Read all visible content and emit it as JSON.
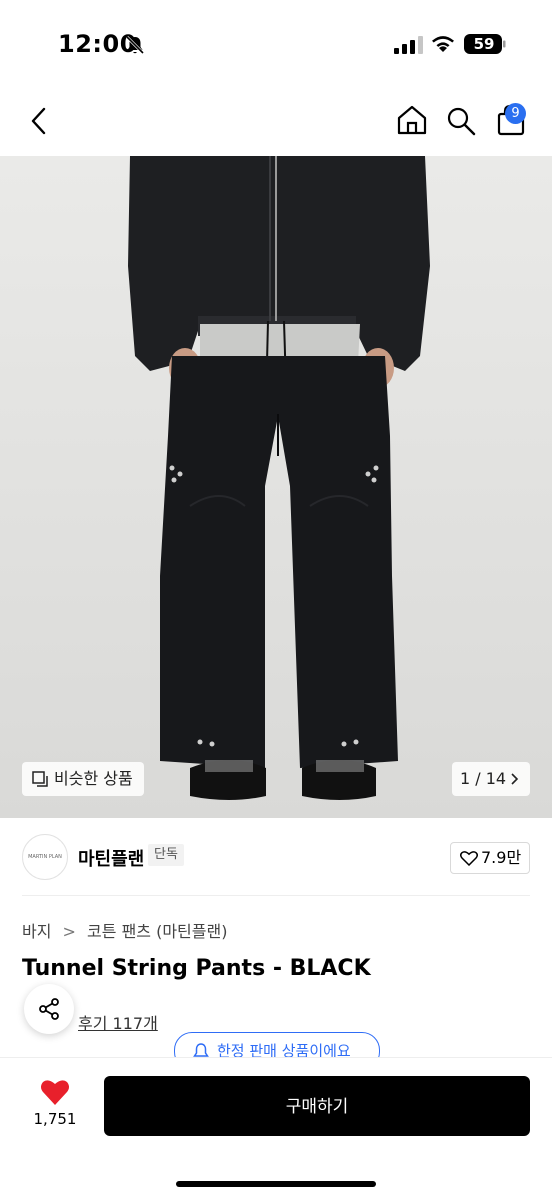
{
  "status_bar": {
    "time": "12:00",
    "battery": "59"
  },
  "nav": {
    "cart_count": "9"
  },
  "hero": {
    "similar_label": "비슷한 상품",
    "page_counter": "1 / 14"
  },
  "brand": {
    "logo_text": "MARTIN PLAN",
    "name": "마틴플랜",
    "badge": "단독",
    "likes": "7.9만"
  },
  "product": {
    "breadcrumb": [
      "바지",
      "코튼 팬츠 (마틴플랜)"
    ],
    "title": "Tunnel String Pants - BLACK",
    "reviews": "후기 117개",
    "limited_banner": "한정 판매 상품이에요"
  },
  "bottom": {
    "heart_count": "1,751",
    "buy_label": "구매하기"
  },
  "colors": {
    "accent": "#2f6df6",
    "heart": "#e8202b",
    "badge_blue": "#2a6ff0"
  }
}
